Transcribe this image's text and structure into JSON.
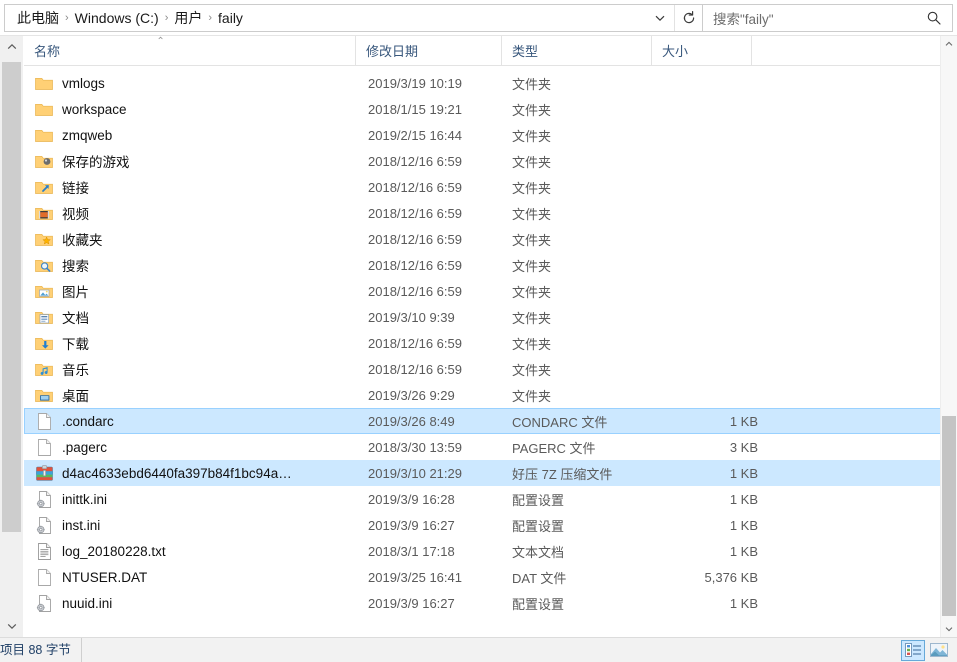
{
  "address": {
    "breadcrumbs": [
      "此电脑",
      "Windows (C:)",
      "用户",
      "faily"
    ],
    "separator": "›",
    "dropdown_icon": "chevron-down-icon",
    "refresh_icon": "refresh-icon"
  },
  "search": {
    "placeholder": "搜索\"faily\"",
    "value": "搜索\"faily\"",
    "icon": "search-icon"
  },
  "columns": {
    "name": "名称",
    "date": "修改日期",
    "type": "类型",
    "size": "大小",
    "sort_indicator": "⌃"
  },
  "files": [
    {
      "name": "vmlogs",
      "date": "2019/3/19 10:19",
      "type": "文件夹",
      "size": "",
      "icon": "folder-icon",
      "selected": false,
      "focused": false
    },
    {
      "name": "workspace",
      "date": "2018/1/15 19:21",
      "type": "文件夹",
      "size": "",
      "icon": "folder-icon",
      "selected": false,
      "focused": false
    },
    {
      "name": "zmqweb",
      "date": "2019/2/15 16:44",
      "type": "文件夹",
      "size": "",
      "icon": "folder-icon",
      "selected": false,
      "focused": false
    },
    {
      "name": "保存的游戏",
      "date": "2018/12/16 6:59",
      "type": "文件夹",
      "size": "",
      "icon": "folder-saved-games-icon",
      "selected": false,
      "focused": false
    },
    {
      "name": "链接",
      "date": "2018/12/16 6:59",
      "type": "文件夹",
      "size": "",
      "icon": "folder-links-icon",
      "selected": false,
      "focused": false
    },
    {
      "name": "视频",
      "date": "2018/12/16 6:59",
      "type": "文件夹",
      "size": "",
      "icon": "folder-videos-icon",
      "selected": false,
      "focused": false
    },
    {
      "name": "收藏夹",
      "date": "2018/12/16 6:59",
      "type": "文件夹",
      "size": "",
      "icon": "folder-favorites-icon",
      "selected": false,
      "focused": false
    },
    {
      "name": "搜索",
      "date": "2018/12/16 6:59",
      "type": "文件夹",
      "size": "",
      "icon": "folder-searches-icon",
      "selected": false,
      "focused": false
    },
    {
      "name": "图片",
      "date": "2018/12/16 6:59",
      "type": "文件夹",
      "size": "",
      "icon": "folder-pictures-icon",
      "selected": false,
      "focused": false
    },
    {
      "name": "文档",
      "date": "2019/3/10 9:39",
      "type": "文件夹",
      "size": "",
      "icon": "folder-documents-icon",
      "selected": false,
      "focused": false
    },
    {
      "name": "下载",
      "date": "2018/12/16 6:59",
      "type": "文件夹",
      "size": "",
      "icon": "folder-downloads-icon",
      "selected": false,
      "focused": false
    },
    {
      "name": "音乐",
      "date": "2018/12/16 6:59",
      "type": "文件夹",
      "size": "",
      "icon": "folder-music-icon",
      "selected": false,
      "focused": false
    },
    {
      "name": "桌面",
      "date": "2019/3/26 9:29",
      "type": "文件夹",
      "size": "",
      "icon": "folder-desktop-icon",
      "selected": false,
      "focused": false
    },
    {
      "name": ".condarc",
      "date": "2019/3/26 8:49",
      "type": "CONDARC 文件",
      "size": "1 KB",
      "icon": "blank-file-icon",
      "selected": true,
      "focused": true
    },
    {
      "name": ".pagerc",
      "date": "2018/3/30 13:59",
      "type": "PAGERC 文件",
      "size": "3 KB",
      "icon": "blank-file-icon",
      "selected": false,
      "focused": false
    },
    {
      "name": "d4ac4633ebd6440fa397b84f1bc94a…",
      "date": "2019/3/10 21:29",
      "type": "好压 7Z 压缩文件",
      "size": "1 KB",
      "icon": "archive-7z-icon",
      "selected": true,
      "focused": false
    },
    {
      "name": "inittk.ini",
      "date": "2019/3/9 16:28",
      "type": "配置设置",
      "size": "1 KB",
      "icon": "ini-config-icon",
      "selected": false,
      "focused": false
    },
    {
      "name": "inst.ini",
      "date": "2019/3/9 16:27",
      "type": "配置设置",
      "size": "1 KB",
      "icon": "ini-config-icon",
      "selected": false,
      "focused": false
    },
    {
      "name": "log_20180228.txt",
      "date": "2018/3/1 17:18",
      "type": "文本文档",
      "size": "1 KB",
      "icon": "text-file-icon",
      "selected": false,
      "focused": false
    },
    {
      "name": "NTUSER.DAT",
      "date": "2019/3/25 16:41",
      "type": "DAT 文件",
      "size": "5,376 KB",
      "icon": "blank-file-icon",
      "selected": false,
      "focused": false
    },
    {
      "name": "nuuid.ini",
      "date": "2019/3/9 16:27",
      "type": "配置设置",
      "size": "1 KB",
      "icon": "ini-config-icon",
      "selected": false,
      "focused": false
    }
  ],
  "statusbar": {
    "text": "项目  88 字节",
    "views": [
      {
        "name": "details-view",
        "label": "详细信息",
        "active": true
      },
      {
        "name": "large-icons-view",
        "label": "大图标",
        "active": false
      }
    ]
  },
  "colors": {
    "selection_fill": "#cce8ff",
    "selection_border": "#99d1ff",
    "header_text": "#38577c",
    "folder_yellow": "#ffd075",
    "status_text": "#1f3f66"
  }
}
